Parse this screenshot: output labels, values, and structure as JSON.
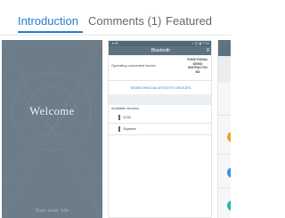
{
  "tabs": [
    {
      "label": "Introduction",
      "active": true
    },
    {
      "label": "Comments (1)",
      "active": false
    },
    {
      "label": "Featured",
      "active": false
    }
  ],
  "colors": {
    "accent": "#1f7fd0",
    "welcome_bg": "#6c7c88",
    "appbar": "#5d7381",
    "dot_orange": "#f2a024",
    "dot_blue": "#3d8fe0",
    "dot_teal": "#2bb5a3"
  },
  "screenshots": {
    "welcome": {
      "title": "Welcome",
      "subtitle": "Your solar life"
    },
    "bluetooth": {
      "status_left": "▾ ✉",
      "status_right": "▿ ◰ ▮ 77%",
      "appbar_title": "Bluetooth",
      "menu_icon": "menu-icon",
      "operating_label": "Operating connected device",
      "side_line1": "FUNCTIONAL",
      "side_line2": "DEMO",
      "side_line3": "INSTRUCTIO",
      "side_line4": "NS",
      "search_label": "SEARCHING BLUETOOTH DEVICES",
      "available_label": "Available devices",
      "devices": [
        "1234",
        "Skywise"
      ]
    }
  }
}
